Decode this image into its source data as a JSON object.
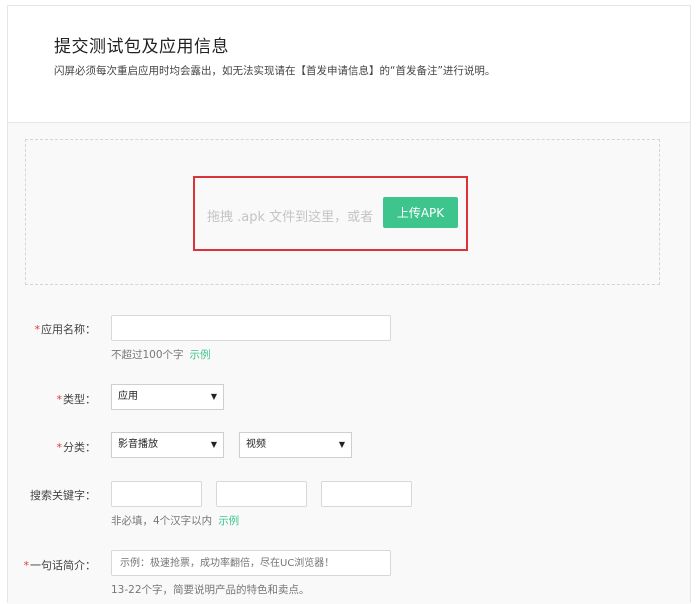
{
  "header": {
    "title": "提交测试包及应用信息",
    "subtitle": "闪屏必须每次重启应用时均会露出，如无法实现请在【首发申请信息】的“首发备注”进行说明。"
  },
  "upload": {
    "drop_text": "拖拽 .apk 文件到这里，或者",
    "button_label": "上传APK",
    "button_color": "#3ec48d",
    "highlight_color": "#d9343a"
  },
  "form": {
    "required_mark": "*",
    "app_name": {
      "label": "应用名称：",
      "value": "",
      "hint": "不超过100个字",
      "example": "示例"
    },
    "type": {
      "label": "类型：",
      "selected": "应用"
    },
    "category": {
      "label": "分类：",
      "primary_selected": "影音播放",
      "secondary_selected": "视频"
    },
    "keywords": {
      "label": "搜索关键字：",
      "values": [
        "",
        "",
        ""
      ],
      "hint": "非必填，4个汉字以内",
      "example": "示例"
    },
    "intro": {
      "label": "一句话简介：",
      "placeholder": "示例：极速抢票，成功率翻倍，尽在UC浏览器！",
      "hint": "13-22个字，简要说明产品的特色和卖点。"
    }
  }
}
